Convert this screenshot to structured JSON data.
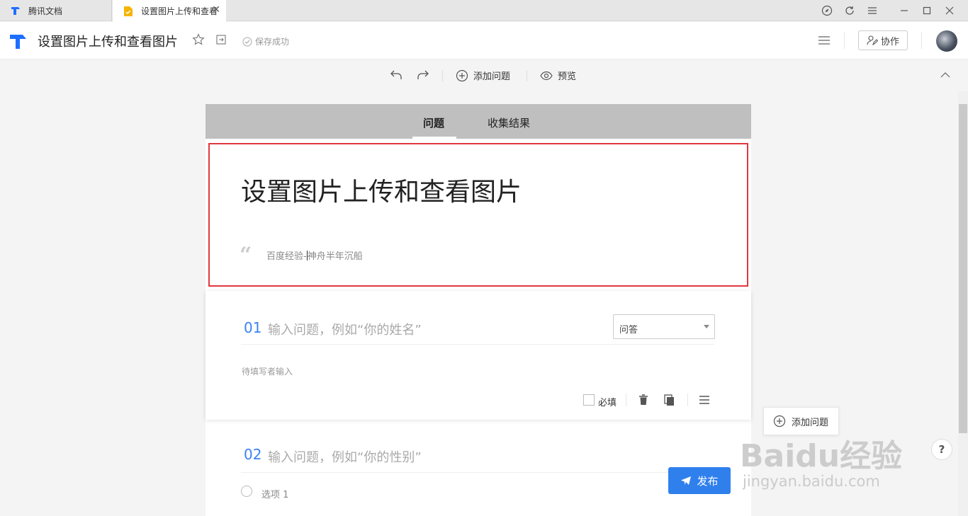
{
  "app": {
    "tabs": [
      {
        "label": "腾讯文档"
      },
      {
        "label": "设置图片上传和查看"
      }
    ]
  },
  "header": {
    "title": "设置图片上传和查看图片",
    "save_status": "保存成功",
    "collab_label": "协作"
  },
  "toolbar": {
    "add_question_label": "添加问题",
    "preview_label": "预览"
  },
  "form": {
    "tabs": [
      {
        "label": "问题"
      },
      {
        "label": "收集结果"
      }
    ],
    "title": "设置图片上传和查看图片",
    "description_before_cursor": "百度经验-",
    "description_after_cursor": "神舟半年沉船",
    "questions": [
      {
        "number": "01",
        "placeholder": "输入问题，例如“你的姓名”",
        "type": "问答",
        "answer_placeholder": "待填写者输入",
        "required_label": "必填"
      },
      {
        "number": "02",
        "placeholder": "输入问题，例如“你的性别”",
        "options": [
          "选项 1"
        ]
      }
    ]
  },
  "side": {
    "add_question_label": "添加问题"
  },
  "publish_label": "发布",
  "help_label": "?",
  "watermark": {
    "main": "Baidu经验",
    "sub": "jingyan.baidu.com"
  },
  "colors": {
    "accent": "#2f80ed",
    "question_number": "#3b82f6",
    "highlight_border": "#e0383e"
  }
}
